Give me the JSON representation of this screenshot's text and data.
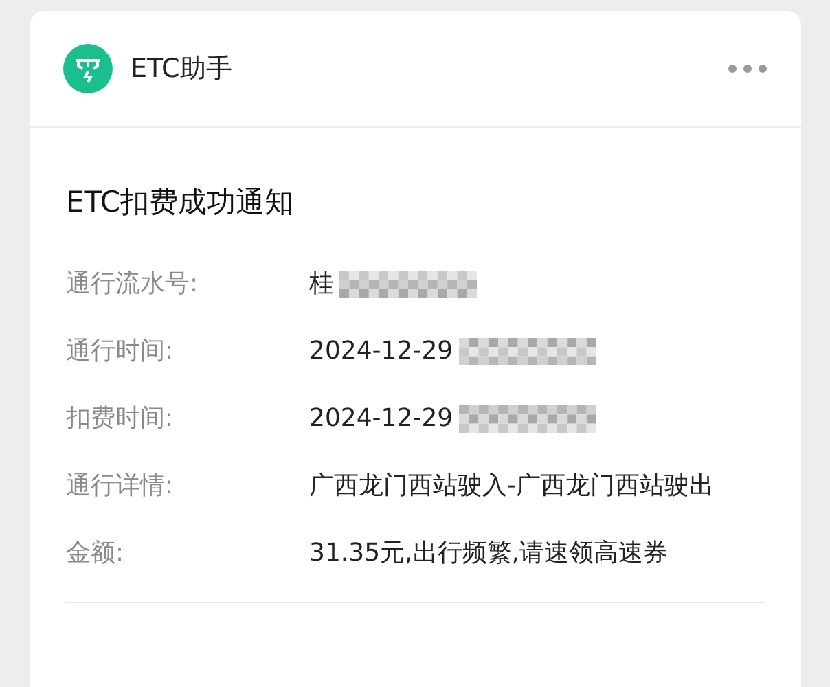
{
  "header": {
    "account_name": "ETC助手"
  },
  "message": {
    "title": "ETC扣费成功通知",
    "rows": [
      {
        "label": "通行流水号:",
        "value": "桂",
        "masked": true
      },
      {
        "label": "通行时间:",
        "value": "2024-12-29",
        "masked": true
      },
      {
        "label": "扣费时间:",
        "value": "2024-12-29",
        "masked": true
      },
      {
        "label": "通行详情:",
        "value": "广西龙门西站驶入-广西龙门西站驶出",
        "masked": false
      },
      {
        "label": "金额:",
        "value": "31.35元,出行频繁,请速领高速券",
        "masked": false
      }
    ]
  }
}
